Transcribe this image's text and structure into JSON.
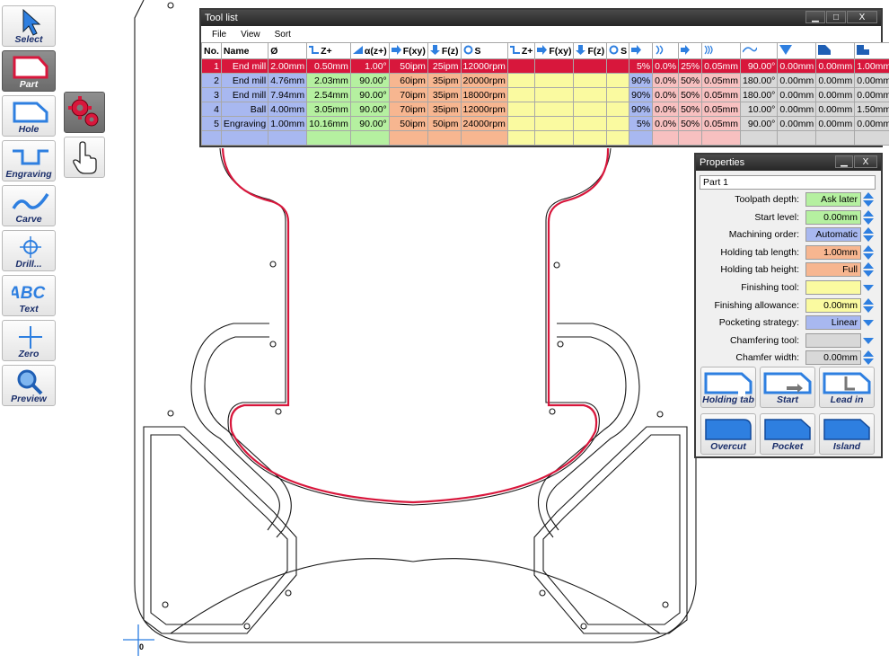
{
  "toolbar": {
    "items": [
      {
        "label": "Select",
        "icon": "arrow-cursor-icon"
      },
      {
        "label": "Part",
        "icon": "part-outline-icon"
      },
      {
        "label": "Hole",
        "icon": "hole-outline-icon"
      },
      {
        "label": "Engraving",
        "icon": "engraving-channel-icon"
      },
      {
        "label": "Carve",
        "icon": "carve-wave-icon"
      },
      {
        "label": "Drill...",
        "icon": "drill-target-icon"
      },
      {
        "label": "Text",
        "icon": "abc-text-icon"
      },
      {
        "label": "Zero",
        "icon": "zero-cross-icon"
      },
      {
        "label": "Preview",
        "icon": "magnifier-icon"
      }
    ],
    "side_buttons": [
      {
        "icon": "gears-settings-icon"
      },
      {
        "icon": "hand-pointer-icon"
      }
    ]
  },
  "canvas": {
    "origin_label": "0"
  },
  "tool_list": {
    "title": "Tool list",
    "window_buttons": [
      "▁",
      "□",
      "X"
    ],
    "menu": [
      "File",
      "View",
      "Sort"
    ],
    "headers": [
      "No.",
      "Name",
      "Ø",
      "Z+",
      "α(z+)",
      "F(xy)",
      "F(z)",
      "S",
      "Z+",
      "F(xy)",
      "F(z)",
      "S"
    ],
    "rows": [
      {
        "no": "1",
        "name": "End mill",
        "dia": "2.00mm",
        "zplus": "0.50mm",
        "alpha": "1.00°",
        "fxy": "50ipm",
        "fz": "25ipm",
        "s": "12000rpm",
        "p1": "5%",
        "p2": "0.0%",
        "p3": "25%",
        "p4": "0.05mm",
        "angle": "90.00°",
        "c1": "0.00mm",
        "c2": "0.00mm",
        "c3": "1.00mm",
        "selected": true
      },
      {
        "no": "2",
        "name": "End mill",
        "dia": "4.76mm",
        "zplus": "2.03mm",
        "alpha": "90.00°",
        "fxy": "60ipm",
        "fz": "35ipm",
        "s": "20000rpm",
        "p1": "90%",
        "p2": "0.0%",
        "p3": "50%",
        "p4": "0.05mm",
        "angle": "180.00°",
        "c1": "0.00mm",
        "c2": "0.00mm",
        "c3": "0.00mm",
        "selected": false
      },
      {
        "no": "3",
        "name": "End mill",
        "dia": "7.94mm",
        "zplus": "2.54mm",
        "alpha": "90.00°",
        "fxy": "70ipm",
        "fz": "35ipm",
        "s": "18000rpm",
        "p1": "90%",
        "p2": "0.0%",
        "p3": "50%",
        "p4": "0.05mm",
        "angle": "180.00°",
        "c1": "0.00mm",
        "c2": "0.00mm",
        "c3": "0.00mm",
        "selected": false
      },
      {
        "no": "4",
        "name": "Ball",
        "dia": "4.00mm",
        "zplus": "3.05mm",
        "alpha": "90.00°",
        "fxy": "70ipm",
        "fz": "35ipm",
        "s": "12000rpm",
        "p1": "90%",
        "p2": "0.0%",
        "p3": "50%",
        "p4": "0.05mm",
        "angle": "10.00°",
        "c1": "0.00mm",
        "c2": "0.00mm",
        "c3": "1.50mm",
        "selected": false
      },
      {
        "no": "5",
        "name": "Engraving",
        "dia": "1.00mm",
        "zplus": "10.16mm",
        "alpha": "90.00°",
        "fxy": "50ipm",
        "fz": "50ipm",
        "s": "24000rpm",
        "p1": "5%",
        "p2": "0.0%",
        "p3": "50%",
        "p4": "0.05mm",
        "angle": "90.00°",
        "c1": "0.00mm",
        "c2": "0.00mm",
        "c3": "0.00mm",
        "selected": false
      }
    ],
    "colors": {
      "blue": "#a8b8f0",
      "green": "#b5f0a0",
      "orange": "#f7b690",
      "yellow": "#fafaa0",
      "pink": "#f7c0c0",
      "gray": "#d8d8d8",
      "selected": "#d8173c"
    }
  },
  "properties": {
    "title": "Properties",
    "window_buttons": [
      "▁",
      "X"
    ],
    "name_value": "Part 1",
    "fields": [
      {
        "label": "Toolpath depth:",
        "value": "Ask later",
        "color": "#b5f0a0",
        "control": "spin"
      },
      {
        "label": "Start level:",
        "value": "0.00mm",
        "color": "#b5f0a0",
        "control": "spin"
      },
      {
        "label": "Machining order:",
        "value": "Automatic",
        "color": "#a8b8f0",
        "control": "spin"
      },
      {
        "label": "Holding tab length:",
        "value": "1.00mm",
        "color": "#f7b690",
        "control": "spin"
      },
      {
        "label": "Holding tab height:",
        "value": "Full",
        "color": "#f7b690",
        "control": "spin"
      },
      {
        "label": "Finishing tool:",
        "value": "",
        "color": "#fafaa0",
        "control": "drop"
      },
      {
        "label": "Finishing allowance:",
        "value": "0.00mm",
        "color": "#fafaa0",
        "control": "spin"
      },
      {
        "label": "Pocketing strategy:",
        "value": "Linear",
        "color": "#a8b8f0",
        "control": "drop"
      },
      {
        "label": "Chamfering tool:",
        "value": "",
        "color": "#d8d8d8",
        "control": "drop"
      },
      {
        "label": "Chamfer width:",
        "value": "0.00mm",
        "color": "#d8d8d8",
        "control": "spin"
      }
    ],
    "buttons": [
      "Holding tab",
      "Start",
      "Lead in",
      "Overcut",
      "Pocket",
      "Island"
    ]
  }
}
